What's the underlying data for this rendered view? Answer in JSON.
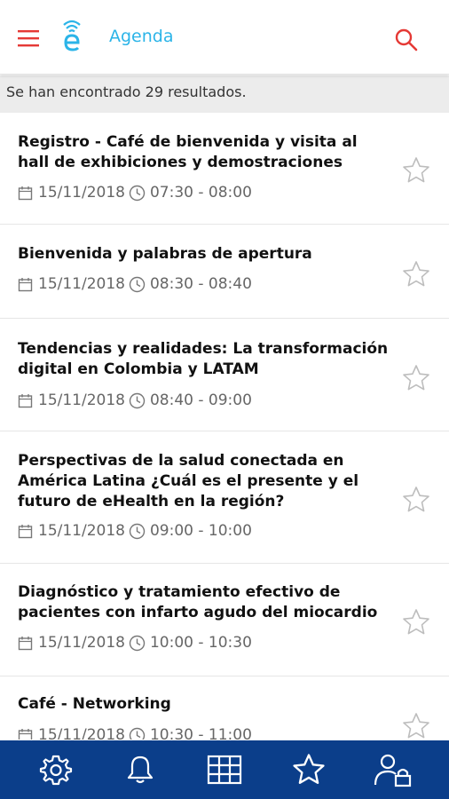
{
  "header": {
    "title": "Agenda",
    "menu_icon": "hamburger-menu-icon",
    "logo_icon": "ehealth-logo-icon",
    "search_icon": "search-icon",
    "accent_color": "#e53935",
    "brand_color": "#2bb4e8"
  },
  "results": {
    "text": "Se han encontrado 29 resultados."
  },
  "events": [
    {
      "title": "Registro - Café de bienvenida y visita al hall de exhibiciones y demostraciones",
      "date": "15/11/2018",
      "time": "07:30 - 08:00"
    },
    {
      "title": "Bienvenida y palabras de apertura",
      "date": "15/11/2018",
      "time": "08:30 - 08:40"
    },
    {
      "title": "Tendencias y realidades: La transformación digital en Colombia y LATAM",
      "date": "15/11/2018",
      "time": "08:40 - 09:00"
    },
    {
      "title": "Perspectivas de la salud conectada en América Latina ¿Cuál es el presente y el futuro de eHealth en la región?",
      "date": "15/11/2018",
      "time": "09:00 - 10:00"
    },
    {
      "title": "Diagnóstico y tratamiento efectivo de pacientes con infarto agudo del miocardio",
      "date": "15/11/2018",
      "time": "10:00 - 10:30"
    },
    {
      "title": "Café - Networking",
      "date": "15/11/2018",
      "time": "10:30 - 11:00"
    }
  ],
  "bottom_nav": {
    "color": "#0b3e8a",
    "items": [
      {
        "icon": "settings-gear-icon"
      },
      {
        "icon": "notifications-bell-icon"
      },
      {
        "icon": "agenda-grid-icon"
      },
      {
        "icon": "favorites-star-icon"
      },
      {
        "icon": "user-lock-icon"
      }
    ]
  }
}
